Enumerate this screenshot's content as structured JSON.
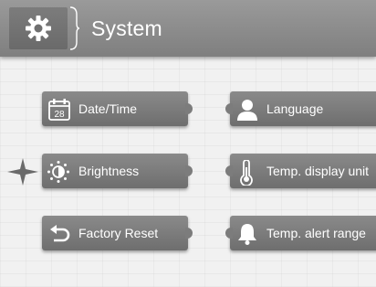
{
  "header": {
    "title": "System",
    "icon": "gear-icon"
  },
  "tiles": {
    "date_time": {
      "label": "Date/Time",
      "icon": "calendar-icon",
      "icon_text": "28"
    },
    "language": {
      "label": "Language",
      "icon": "person-icon"
    },
    "brightness": {
      "label": "Brightness",
      "icon": "sun-icon"
    },
    "temp_display_unit": {
      "label": "Temp. display unit",
      "icon": "thermometer-icon"
    },
    "factory_reset": {
      "label": "Factory Reset",
      "icon": "reset-arrow-icon"
    },
    "temp_alert_range": {
      "label": "Temp. alert range",
      "icon": "bell-icon"
    }
  },
  "selection": {
    "selected_tile": "Brightness",
    "indicator_icon": "sparkle-selector-icon"
  },
  "colors": {
    "header_bg": "#8c8c8c",
    "tile_bg": "#7a7a7a",
    "text": "#ffffff",
    "page_bg": "#f1f1f1"
  }
}
